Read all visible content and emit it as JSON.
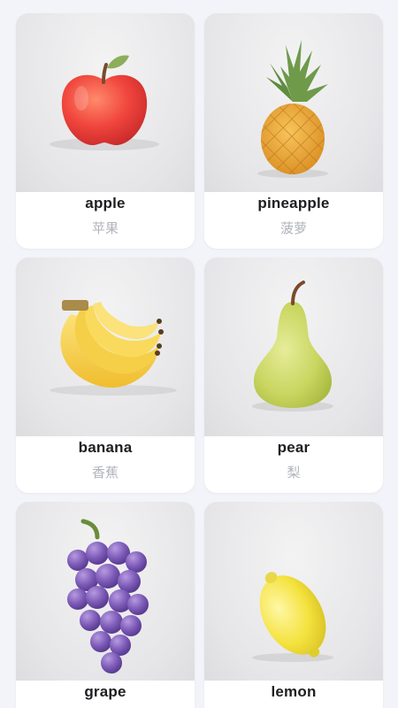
{
  "fruits": [
    {
      "english": "apple",
      "chinese": "苹果",
      "icon": "apple-illustration"
    },
    {
      "english": "pineapple",
      "chinese": "菠萝",
      "icon": "pineapple-illustration"
    },
    {
      "english": "banana",
      "chinese": "香蕉",
      "icon": "banana-illustration"
    },
    {
      "english": "pear",
      "chinese": "梨",
      "icon": "pear-illustration"
    },
    {
      "english": "grape",
      "chinese": "",
      "icon": "grape-illustration"
    },
    {
      "english": "lemon",
      "chinese": "",
      "icon": "lemon-illustration"
    }
  ],
  "colors": {
    "background": "#f3f4f9",
    "card": "#ffffff",
    "english_text": "#1e1e22",
    "chinese_text": "#b0b3bb"
  }
}
